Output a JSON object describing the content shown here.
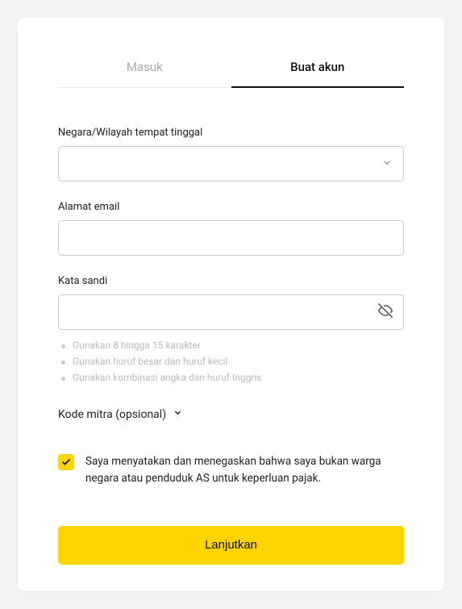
{
  "tabs": {
    "login": "Masuk",
    "signup": "Buat akun"
  },
  "fields": {
    "country_label": "Negara/Wilayah tempat tinggal",
    "email_label": "Alamat email",
    "password_label": "Kata sandi"
  },
  "password_hints": [
    "Gunakan 8 hingga 15 karakter",
    "Gunakan huruf besar dan huruf kecil",
    "Gunakan kombinasi angka dan huruf Inggris"
  ],
  "partner_code_label": "Kode mitra (opsional)",
  "agreement_text": "Saya menyatakan dan menegaskan bahwa saya bukan warga negara atau penduduk AS untuk keperluan pajak.",
  "submit_label": "Lanjutkan"
}
